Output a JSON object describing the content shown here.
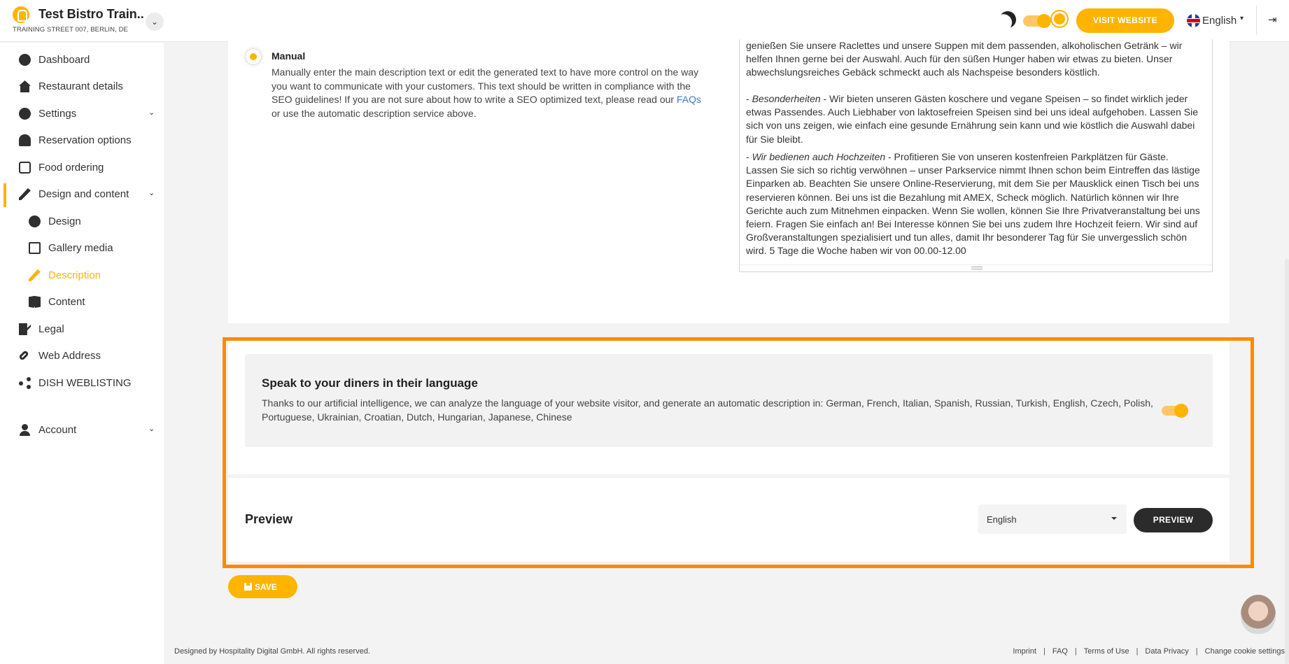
{
  "header": {
    "brand_name": "Test Bistro Train..",
    "brand_address": "TRAINING STREET 007, BERLIN, DE",
    "visit_label": "VISIT WEBSITE",
    "language": "English"
  },
  "sidebar": {
    "items": [
      {
        "label": "Dashboard",
        "icon": "dashboard-icon"
      },
      {
        "label": "Restaurant details",
        "icon": "home-icon"
      },
      {
        "label": "Settings",
        "icon": "gear-icon"
      },
      {
        "label": "Reservation options",
        "icon": "bell-icon"
      },
      {
        "label": "Food ordering",
        "icon": "bike-icon"
      },
      {
        "label": "Design and content",
        "icon": "brush-icon"
      },
      {
        "label": "Design",
        "icon": "palette-icon"
      },
      {
        "label": "Gallery media",
        "icon": "images-icon"
      },
      {
        "label": "Description",
        "icon": "brush-icon"
      },
      {
        "label": "Content",
        "icon": "book-icon"
      },
      {
        "label": "Legal",
        "icon": "legal-icon"
      },
      {
        "label": "Web Address",
        "icon": "link-icon"
      },
      {
        "label": "DISH WEBLISTING",
        "icon": "share-icon"
      },
      {
        "label": "Account",
        "icon": "user-icon"
      }
    ]
  },
  "manual": {
    "title": "Manual",
    "desc_before": "Manually enter the main description text or edit the generated text to have more control on the way you want to communicate with your customers. This text should be written in compliance with the SEO guidelines! If you are not sure about how to write a SEO optimized text, please read our ",
    "faq_link": "FAQs",
    "desc_after": " or use the automatic description service above."
  },
  "description_text": {
    "p1": "genießen Sie unsere Raclettes und unsere Suppen mit dem passenden, alkoholischen Getränk – wir helfen Ihnen gerne bei der Auswahl. Auch für den süßen Hunger haben wir etwas zu bieten. Unser abwechslungsreiches Gebäck schmeckt auch als Nachspeise besonders köstlich.",
    "p2_heading": "Besonderheiten",
    "p2": " - Wir bieten unseren Gästen koschere und vegane Speisen – so findet wirklich jeder etwas Passendes. Auch Liebhaber von laktosefreien Speisen sind bei uns ideal aufgehoben. Lassen Sie sich von uns zeigen, wie einfach eine gesunde Ernährung sein kann und wie köstlich die Auswahl dabei für Sie bleibt.",
    "p3_heading": "Wir bedienen auch Hochzeiten",
    "p3": " - Profitieren Sie von unseren kostenfreien Parkplätzen für Gäste. Lassen Sie sich so richtig verwöhnen – unser Parkservice nimmt Ihnen schon beim Eintreffen das lästige Einparken ab. Beachten Sie unsere Online-Reservierung, mit dem Sie per Mausklick einen Tisch bei uns reservieren können. Bei uns ist die Bezahlung mit AMEX, Scheck möglich. Natürlich können wir Ihre Gerichte auch zum Mitnehmen einpacken. Wenn Sie wollen, können Sie Ihre Privatveranstaltung bei uns feiern. Fragen Sie einfach an! Bei Interesse können Sie bei uns zudem Ihre Hochzeit feiern. Wir sind auf Großveranstaltungen spezialisiert und tun alles, damit Ihr besonderer Tag für Sie unvergesslich schön wird. 5 Tage die Woche haben wir von 00.00-12.00"
  },
  "language_section": {
    "title": "Speak to your diners in their language",
    "description": "Thanks to our artificial intelligence, we can analyze the language of your website visitor, and generate an automatic description in: German, French, Italian, Spanish, Russian, Turkish, English, Czech, Polish, Portuguese, Ukrainian, Croatian, Dutch, Hungarian, Japanese, Chinese",
    "toggle_on": true
  },
  "preview": {
    "title": "Preview",
    "selected_language": "English",
    "button_label": "PREVIEW"
  },
  "save_label": "SAVE",
  "footer": {
    "copyright": "Designed by Hospitality Digital GmbH. All rights reserved.",
    "links": [
      "Imprint",
      "FAQ",
      "Terms of Use",
      "Data Privacy",
      "Change cookie settings"
    ]
  },
  "colors": {
    "accent": "#ffb400",
    "highlight": "#ff8a00",
    "dark_button": "#2b2b2b"
  }
}
